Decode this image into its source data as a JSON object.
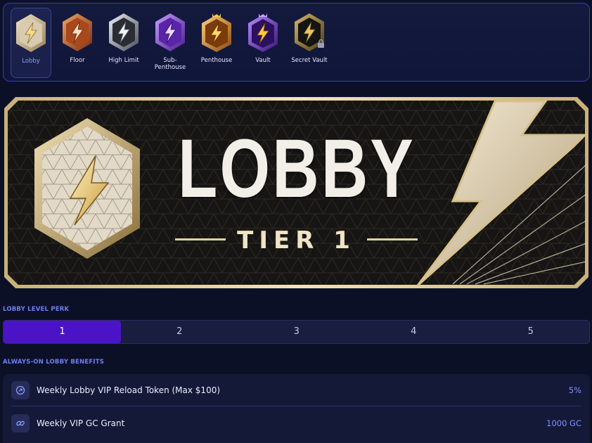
{
  "tiers": [
    {
      "label": "Lobby",
      "active": true
    },
    {
      "label": "Floor",
      "active": false
    },
    {
      "label": "High Limit",
      "active": false
    },
    {
      "label": "Sub-Penthouse",
      "active": false
    },
    {
      "label": "Penthouse",
      "active": false
    },
    {
      "label": "Vault",
      "active": false
    },
    {
      "label": "Secret Vault",
      "active": false,
      "locked": true
    }
  ],
  "banner": {
    "title": "LOBBY",
    "subtitle": "TIER 1"
  },
  "perk_section": {
    "heading": "LOBBY LEVEL PERK",
    "tabs": [
      "1",
      "2",
      "3",
      "4",
      "5"
    ],
    "selected": "1"
  },
  "benefits_section": {
    "heading": "ALWAYS-ON LOBBY BENEFITS",
    "items": [
      {
        "label": "Weekly Lobby VIP Reload Token (Max $100)",
        "value": "5%",
        "icon": "reload-token-icon"
      },
      {
        "label": "Weekly VIP GC Grant",
        "value": "1000 GC",
        "icon": "link-coin-icon"
      }
    ]
  },
  "colors": {
    "accent": "#4a14c6",
    "heading": "#6f7ff0",
    "value": "#8192ff",
    "gold": "#d9c28b"
  }
}
